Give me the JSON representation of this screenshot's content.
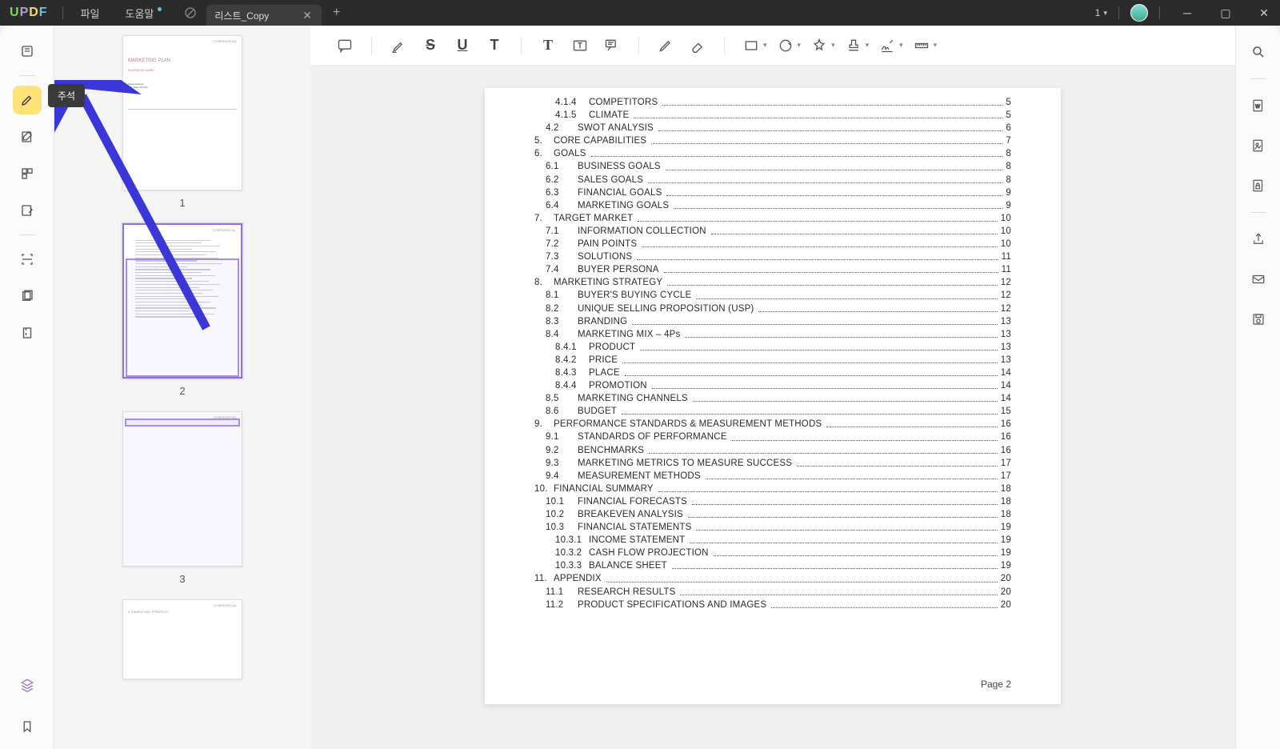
{
  "titlebar": {
    "menu_file": "파일",
    "menu_help": "도움말",
    "tab_title": "리스트_Copy",
    "page_indicator": "1"
  },
  "left_rail_tooltip": "주석",
  "thumbnails": [
    {
      "label": "1",
      "conf": "CONFIDENTIAL",
      "heading": "MARKETING PLAN",
      "sub": "BUSINESS NAME",
      "addr1": "Street Address",
      "addr2": "City, State and Zip"
    },
    {
      "label": "2",
      "conf": "CONFIDENTIAL"
    },
    {
      "label": "3",
      "conf": "CONFIDENTIAL"
    }
  ],
  "doc": {
    "footer": "Page 2",
    "toc": [
      {
        "ind": 2,
        "num": "4.1.4",
        "title": "COMPETITORS",
        "pg": "5"
      },
      {
        "ind": 2,
        "num": "4.1.5",
        "title": "CLIMATE",
        "pg": "5"
      },
      {
        "ind": 1,
        "num": "4.2",
        "title": "SWOT ANALYSIS",
        "pg": "6"
      },
      {
        "ind": 0,
        "num": "5.",
        "title": "CORE CAPABILITIES",
        "pg": "7"
      },
      {
        "ind": 0,
        "num": "6.",
        "title": "GOALS",
        "pg": "8"
      },
      {
        "ind": 1,
        "num": "6.1",
        "title": "BUSINESS GOALS",
        "pg": "8"
      },
      {
        "ind": 1,
        "num": "6.2",
        "title": "SALES GOALS",
        "pg": "8"
      },
      {
        "ind": 1,
        "num": "6.3",
        "title": "FINANCIAL GOALS",
        "pg": "9"
      },
      {
        "ind": 1,
        "num": "6.4",
        "title": "MARKETING GOALS",
        "pg": "9"
      },
      {
        "ind": 0,
        "num": "7.",
        "title": "TARGET MARKET",
        "pg": "10"
      },
      {
        "ind": 1,
        "num": "7.1",
        "title": "INFORMATION COLLECTION",
        "pg": "10"
      },
      {
        "ind": 1,
        "num": "7.2",
        "title": "PAIN POINTS",
        "pg": "10"
      },
      {
        "ind": 1,
        "num": "7.3",
        "title": "SOLUTIONS",
        "pg": "11"
      },
      {
        "ind": 1,
        "num": "7.4",
        "title": "BUYER PERSONA",
        "pg": "11"
      },
      {
        "ind": 0,
        "num": "8.",
        "title": "MARKETING STRATEGY",
        "pg": "12"
      },
      {
        "ind": 1,
        "num": "8.1",
        "title": "BUYER'S BUYING CYCLE",
        "pg": "12"
      },
      {
        "ind": 1,
        "num": "8.2",
        "title": "UNIQUE SELLING PROPOSITION (USP)",
        "pg": "12"
      },
      {
        "ind": 1,
        "num": "8.3",
        "title": "BRANDING",
        "pg": "13"
      },
      {
        "ind": 1,
        "num": "8.4",
        "title": "MARKETING MIX – 4Ps",
        "pg": "13"
      },
      {
        "ind": 2,
        "num": "8.4.1",
        "title": "PRODUCT",
        "pg": "13"
      },
      {
        "ind": 2,
        "num": "8.4.2",
        "title": "PRICE",
        "pg": "13"
      },
      {
        "ind": 2,
        "num": "8.4.3",
        "title": "PLACE",
        "pg": "14"
      },
      {
        "ind": 2,
        "num": "8.4.4",
        "title": "PROMOTION",
        "pg": "14"
      },
      {
        "ind": 1,
        "num": "8.5",
        "title": "MARKETING CHANNELS",
        "pg": "14"
      },
      {
        "ind": 1,
        "num": "8.6",
        "title": "BUDGET",
        "pg": "15"
      },
      {
        "ind": 0,
        "num": "9.",
        "title": "PERFORMANCE STANDARDS & MEASUREMENT METHODS",
        "pg": "16"
      },
      {
        "ind": 1,
        "num": "9.1",
        "title": "STANDARDS OF PERFORMANCE",
        "pg": "16"
      },
      {
        "ind": 1,
        "num": "9.2",
        "title": "BENCHMARKS",
        "pg": "16"
      },
      {
        "ind": 1,
        "num": "9.3",
        "title": "MARKETING METRICS TO MEASURE SUCCESS",
        "pg": "17"
      },
      {
        "ind": 1,
        "num": "9.4",
        "title": "MEASUREMENT METHODS",
        "pg": "17"
      },
      {
        "ind": 0,
        "num": "10.",
        "title": "FINANCIAL SUMMARY",
        "pg": "18"
      },
      {
        "ind": 1,
        "num": "10.1",
        "title": "FINANCIAL FORECASTS",
        "pg": "18"
      },
      {
        "ind": 1,
        "num": "10.2",
        "title": "BREAKEVEN ANALYSIS",
        "pg": "18"
      },
      {
        "ind": 1,
        "num": "10.3",
        "title": "FINANCIAL STATEMENTS",
        "pg": "19"
      },
      {
        "ind": 2,
        "num": "10.3.1",
        "title": "INCOME STATEMENT",
        "pg": "19"
      },
      {
        "ind": 2,
        "num": "10.3.2",
        "title": "CASH FLOW PROJECTION",
        "pg": "19"
      },
      {
        "ind": 2,
        "num": "10.3.3",
        "title": "BALANCE SHEET",
        "pg": "19"
      },
      {
        "ind": 0,
        "num": "11.",
        "title": "APPENDIX",
        "pg": "20"
      },
      {
        "ind": 1,
        "num": "11.1",
        "title": "RESEARCH RESULTS",
        "pg": "20"
      },
      {
        "ind": 1,
        "num": "11.2",
        "title": "PRODUCT SPECIFICATIONS AND IMAGES",
        "pg": "20"
      }
    ]
  }
}
